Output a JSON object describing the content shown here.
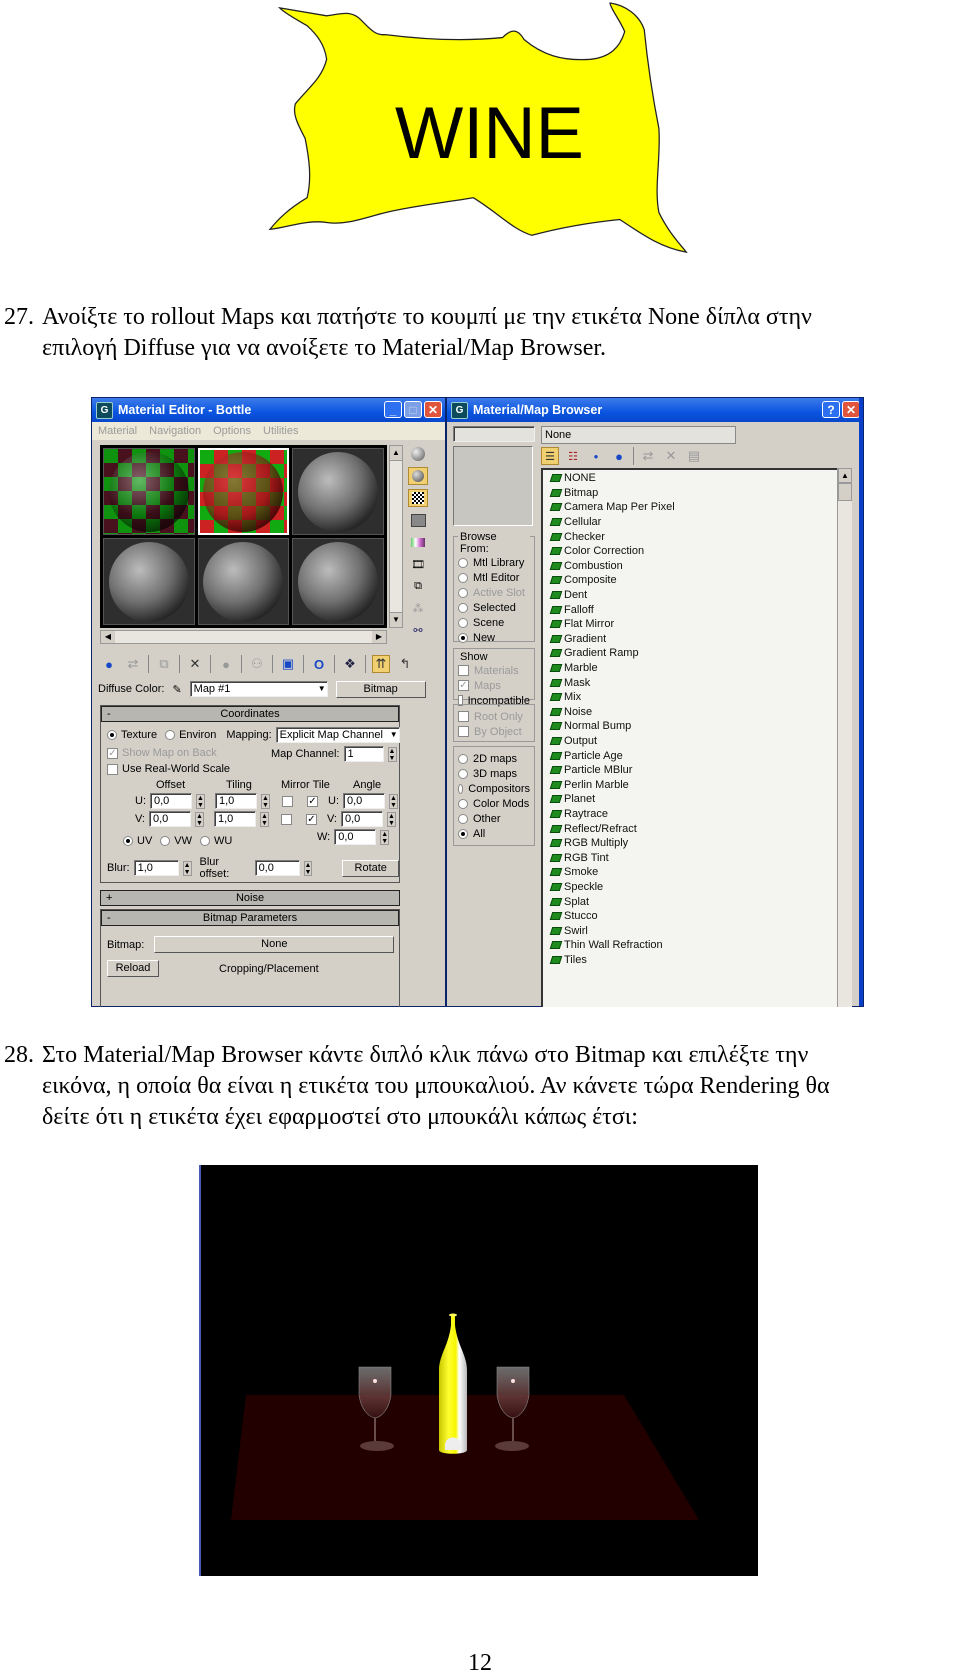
{
  "label_image": {
    "text": "WINE",
    "fill_color": "#ffff00"
  },
  "steps": [
    {
      "number": "27.",
      "line1": "Ανοίξτε το rollout Maps και πατήστε το κουμπί με την ετικέτα None δίπλα στην",
      "line2": "επιλογή Diffuse για να ανοίξετε το Material/Map Browser."
    },
    {
      "number": "28.",
      "line1": "Στο Material/Map Browser κάντε διπλό κλικ πάνω στο Bitmap και επιλέξτε την",
      "line2": "εικόνα, η οποία θα είναι η ετικέτα του μπουκαλιού. Αν κάνετε τώρα Rendering θα",
      "line3": "δείτε ότι η ετικέτα έχει εφαρμοστεί στο μπουκάλι κάπως έτσι:"
    }
  ],
  "material_editor": {
    "title": "Material Editor - Bottle",
    "menu": [
      "Material",
      "Navigation",
      "Options",
      "Utilities"
    ],
    "diffuse_label": "Diffuse Color:",
    "map_name": "Map #1",
    "map_type_button": "Bitmap",
    "coordinates": {
      "header": "Coordinates",
      "texture_label": "Texture",
      "environ_label": "Environ",
      "mapping_label": "Mapping:",
      "mapping_value": "Explicit Map Channel",
      "show_map_on_back": "Show Map on Back",
      "map_channel_label": "Map Channel:",
      "map_channel_value": "1",
      "use_real_world_scale": "Use Real-World Scale",
      "offset_label": "Offset",
      "tiling_label": "Tiling",
      "mirror_tile_label": "Mirror Tile",
      "angle_label": "Angle",
      "u_label": "U:",
      "v_label": "V:",
      "w_label": "W:",
      "offset_u": "0,0",
      "offset_v": "0,0",
      "tiling_u": "1,0",
      "tiling_v": "1,0",
      "angle_u": "0,0",
      "angle_v": "0,0",
      "angle_w": "0,0",
      "uv_label": "UV",
      "vw_label": "VW",
      "wu_label": "WU",
      "blur_label": "Blur:",
      "blur_value": "1,0",
      "blur_offset_label": "Blur offset:",
      "blur_offset_value": "0,0",
      "rotate_button": "Rotate"
    },
    "noise_header": "Noise",
    "bitmap_params_header": "Bitmap Parameters",
    "bitmap_label": "Bitmap:",
    "bitmap_value": "None",
    "reload_button": "Reload",
    "cropping_label": "Cropping/Placement"
  },
  "map_browser": {
    "title": "Material/Map Browser",
    "name_value": "None",
    "browse_from": {
      "title": "Browse From:",
      "options": [
        "Mtl Library",
        "Mtl Editor",
        "Active Slot",
        "Selected",
        "Scene",
        "New"
      ],
      "selected": "New"
    },
    "show": {
      "title": "Show",
      "options": [
        "Materials",
        "Maps",
        "Incompatible"
      ]
    },
    "root_only": "Root Only",
    "by_object": "By Object",
    "categories": {
      "options": [
        "2D maps",
        "3D maps",
        "Compositors",
        "Color Mods",
        "Other",
        "All"
      ],
      "selected": "All"
    },
    "maps": [
      "NONE",
      "Bitmap",
      "Camera Map Per Pixel",
      "Cellular",
      "Checker",
      "Color Correction",
      "Combustion",
      "Composite",
      "Dent",
      "Falloff",
      "Flat Mirror",
      "Gradient",
      "Gradient Ramp",
      "Marble",
      "Mask",
      "Mix",
      "Noise",
      "Normal Bump",
      "Output",
      "Particle Age",
      "Particle MBlur",
      "Perlin Marble",
      "Planet",
      "Raytrace",
      "Reflect/Refract",
      "RGB Multiply",
      "RGB Tint",
      "Smoke",
      "Speckle",
      "Splat",
      "Stucco",
      "Swirl",
      "Thin Wall Refraction",
      "Tiles"
    ]
  },
  "page_number": "12"
}
